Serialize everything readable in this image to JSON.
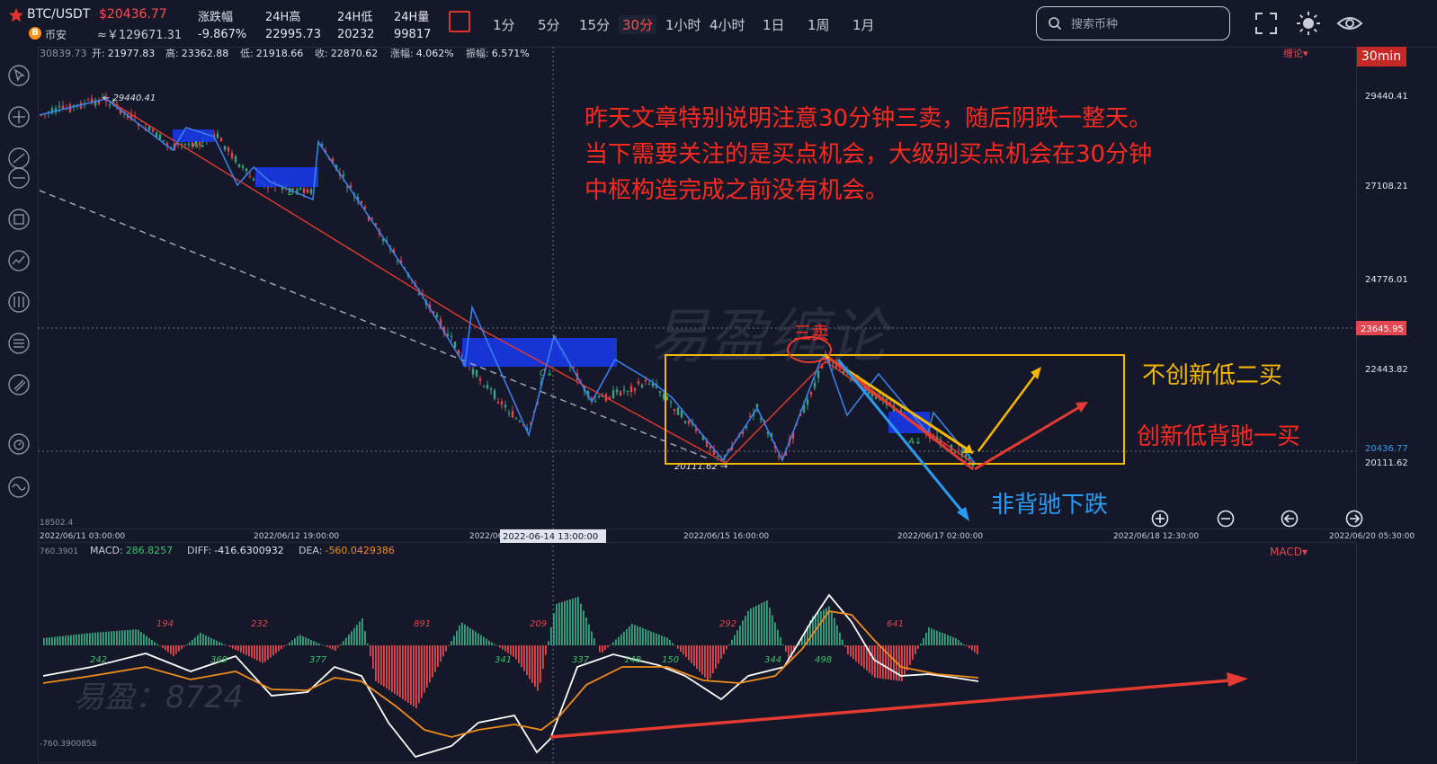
{
  "header": {
    "symbol": "BTC/USDT",
    "price": "$20436.77",
    "exchange": "币安",
    "exchange_icon_letter": "B",
    "cny_price": "≈￥129671.31",
    "stats": [
      {
        "label": "涨跌幅",
        "value": "-9.867%"
      },
      {
        "label": "24H高",
        "value": "22995.73"
      },
      {
        "label": "24H低",
        "value": "20232"
      },
      {
        "label": "24H量",
        "value": "99817"
      }
    ],
    "timeframes": [
      "1分",
      "5分",
      "15分",
      "30分",
      "1小时",
      "4小时",
      "1日",
      "1周",
      "1月"
    ],
    "active_timeframe": "30分",
    "search_placeholder": "搜索币种",
    "icons": [
      "star-icon",
      "fullscreen-icon",
      "theme-sun-icon",
      "eye-icon"
    ]
  },
  "toolbar_icons": [
    "cursor-icon",
    "crosshair-icon",
    "trendline-icon",
    "horizontal-line-icon",
    "rectangle-icon",
    "curve-icon",
    "channel-icon",
    "fibonacci-icon",
    "brush-icon",
    "ruler-icon",
    "clock-icon",
    "wave-icon"
  ],
  "ohlc_bar": {
    "top_price": "30839.73",
    "open_label": "开:",
    "open": "21977.83",
    "high_label": "高:",
    "high": "23362.88",
    "low_label": "低:",
    "low": "21918.66",
    "close_label": "收:",
    "close": "22870.62",
    "change_label": "涨幅:",
    "change": "4.062%",
    "amp_label": "振幅:",
    "amp": "6.571%",
    "indicator": "缠论▾",
    "timeframe_badge": "30min",
    "bottom_price": "18502.4"
  },
  "price_axis": [
    "29440.41",
    "27108.21",
    "24776.01",
    "23645.95",
    "22443.82",
    "20436.77",
    "20111.62"
  ],
  "chart_labels": {
    "high_marker": "← 29440.41",
    "low_marker": "20111.62 →",
    "zone_a1": "A↓",
    "zone_b": "B↓",
    "zone_c": "C↓",
    "zone_a2": "A↓"
  },
  "time_axis": [
    "2022/06/11 03:00:00",
    "2022/06/12 19:00:00",
    "2022/06",
    "2022/06/15 16:00:00",
    "2022/06/17 02:00:00",
    "2022/06/18 12:30:00",
    "2022/06/20 05:30:00"
  ],
  "crosshair_time": "2022-06-14 13:00:00",
  "annotations": {
    "line1": "昨天文章特别说明注意30分钟三卖，随后阴跌一整天。",
    "line2": "当下需要关注的是买点机会，大级别买点机会在30分钟",
    "line3": "中枢构造完成之前没有机会。",
    "third_sell": "三卖",
    "second_buy": "不创新低二买",
    "first_buy": "创新低背驰一买",
    "no_divergence": "非背驰下跌",
    "watermark": "易盈缠论"
  },
  "macd": {
    "top_value": "760.3901",
    "macd_label": "MACD:",
    "macd": "286.8257",
    "diff_label": "DIFF:",
    "diff": "-416.6300932",
    "dea_label": "DEA:",
    "dea": "-560.0429386",
    "indicator": "MACD▾",
    "bottom_value": "-760.3900858",
    "area_labels_top": [
      "194",
      "232",
      "891",
      "209",
      "292",
      "641"
    ],
    "area_labels_bottom": [
      "242",
      "369",
      "377",
      "341",
      "337",
      "148",
      "150",
      "344",
      "498"
    ],
    "watermark": "易盈：8724"
  },
  "zoom_controls": [
    "zoom-in-icon",
    "zoom-out-icon",
    "scroll-left-icon",
    "scroll-right-icon"
  ],
  "colors": {
    "up": "#35a480",
    "down": "#e2464f",
    "stroke_blue": "#3c7eed",
    "stroke_red": "#e53a31",
    "annotation_red": "#ff2a1f",
    "yellow": "#f5b800",
    "cyan": "#2a9bf0"
  }
}
